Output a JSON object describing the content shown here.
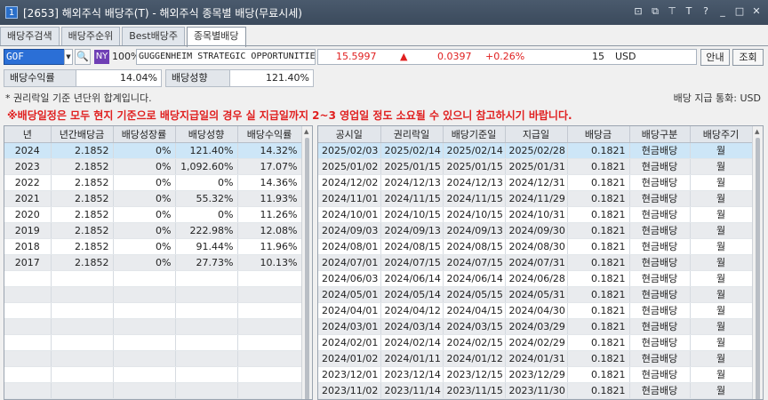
{
  "window": {
    "title_num": "1",
    "title": "[2653] 해외주식 배당주(T) - 해외주식 종목별 배당(무료시세)",
    "controls": [
      "⊡",
      "⧉",
      "⊤",
      "T",
      "?",
      "_",
      "□",
      "✕"
    ]
  },
  "tabs": [
    {
      "label": "배당주검색"
    },
    {
      "label": "배당주순위"
    },
    {
      "label": "Best배당주"
    },
    {
      "label": "종목별배당"
    }
  ],
  "search": {
    "symbol": "GOF",
    "exchange": "NY",
    "percent": "100%",
    "name": "GUGGENHEIM STRATEGIC OPPORTUNITIES",
    "price": "15.5997",
    "arrow": "▲",
    "change": "0.0397",
    "change_pct": "+0.26%",
    "volume": "15",
    "currency": "USD",
    "btn_info": "안내",
    "btn_query": "조회"
  },
  "yield": {
    "label1": "배당수익률",
    "value1": "14.04%",
    "label2": "배당성향",
    "value2": "121.40%"
  },
  "notes": {
    "note1": "* 권리락일 기준 년단위 합계입니다.",
    "currency": "배당 지급 통화: USD",
    "warning": "※배당일정은 모두 현지 기준으로 배당지급일의 경우 실 지급일까지 2~3 영업일 정도 소요될 수 있으니 참고하시기 바랍니다."
  },
  "left_table": {
    "headers": [
      "년",
      "년간배당금",
      "배당성장률",
      "배당성향",
      "배당수익률"
    ],
    "rows": [
      [
        "2024",
        "2.1852",
        "0%",
        "121.40%",
        "14.32%"
      ],
      [
        "2023",
        "2.1852",
        "0%",
        "1,092.60%",
        "17.07%"
      ],
      [
        "2022",
        "2.1852",
        "0%",
        "0%",
        "14.36%"
      ],
      [
        "2021",
        "2.1852",
        "0%",
        "55.32%",
        "11.93%"
      ],
      [
        "2020",
        "2.1852",
        "0%",
        "0%",
        "11.26%"
      ],
      [
        "2019",
        "2.1852",
        "0%",
        "222.98%",
        "12.08%"
      ],
      [
        "2018",
        "2.1852",
        "0%",
        "91.44%",
        "11.96%"
      ],
      [
        "2017",
        "2.1852",
        "0%",
        "27.73%",
        "10.13%"
      ]
    ]
  },
  "right_table": {
    "headers": [
      "공시일",
      "권리락일",
      "배당기준일",
      "지급일",
      "배당금",
      "배당구분",
      "배당주기"
    ],
    "rows": [
      [
        "2025/02/03",
        "2025/02/14",
        "2025/02/14",
        "2025/02/28",
        "0.1821",
        "현금배당",
        "월"
      ],
      [
        "2025/01/02",
        "2025/01/15",
        "2025/01/15",
        "2025/01/31",
        "0.1821",
        "현금배당",
        "월"
      ],
      [
        "2024/12/02",
        "2024/12/13",
        "2024/12/13",
        "2024/12/31",
        "0.1821",
        "현금배당",
        "월"
      ],
      [
        "2024/11/01",
        "2024/11/15",
        "2024/11/15",
        "2024/11/29",
        "0.1821",
        "현금배당",
        "월"
      ],
      [
        "2024/10/01",
        "2024/10/15",
        "2024/10/15",
        "2024/10/31",
        "0.1821",
        "현금배당",
        "월"
      ],
      [
        "2024/09/03",
        "2024/09/13",
        "2024/09/13",
        "2024/09/30",
        "0.1821",
        "현금배당",
        "월"
      ],
      [
        "2024/08/01",
        "2024/08/15",
        "2024/08/15",
        "2024/08/30",
        "0.1821",
        "현금배당",
        "월"
      ],
      [
        "2024/07/01",
        "2024/07/15",
        "2024/07/15",
        "2024/07/31",
        "0.1821",
        "현금배당",
        "월"
      ],
      [
        "2024/06/03",
        "2024/06/14",
        "2024/06/14",
        "2024/06/28",
        "0.1821",
        "현금배당",
        "월"
      ],
      [
        "2024/05/01",
        "2024/05/14",
        "2024/05/15",
        "2024/05/31",
        "0.1821",
        "현금배당",
        "월"
      ],
      [
        "2024/04/01",
        "2024/04/12",
        "2024/04/15",
        "2024/04/30",
        "0.1821",
        "현금배당",
        "월"
      ],
      [
        "2024/03/01",
        "2024/03/14",
        "2024/03/15",
        "2024/03/29",
        "0.1821",
        "현금배당",
        "월"
      ],
      [
        "2024/02/01",
        "2024/02/14",
        "2024/02/15",
        "2024/02/29",
        "0.1821",
        "현금배당",
        "월"
      ],
      [
        "2024/01/02",
        "2024/01/11",
        "2024/01/12",
        "2024/01/31",
        "0.1821",
        "현금배당",
        "월"
      ],
      [
        "2023/12/01",
        "2023/12/14",
        "2023/12/15",
        "2023/12/29",
        "0.1821",
        "현금배당",
        "월"
      ],
      [
        "2023/11/02",
        "2023/11/14",
        "2023/11/15",
        "2023/11/30",
        "0.1821",
        "현금배당",
        "월"
      ]
    ]
  },
  "colors": {
    "accent": "#2b6fd6",
    "up": "#e02020",
    "selected_row": "#cde6f7"
  }
}
